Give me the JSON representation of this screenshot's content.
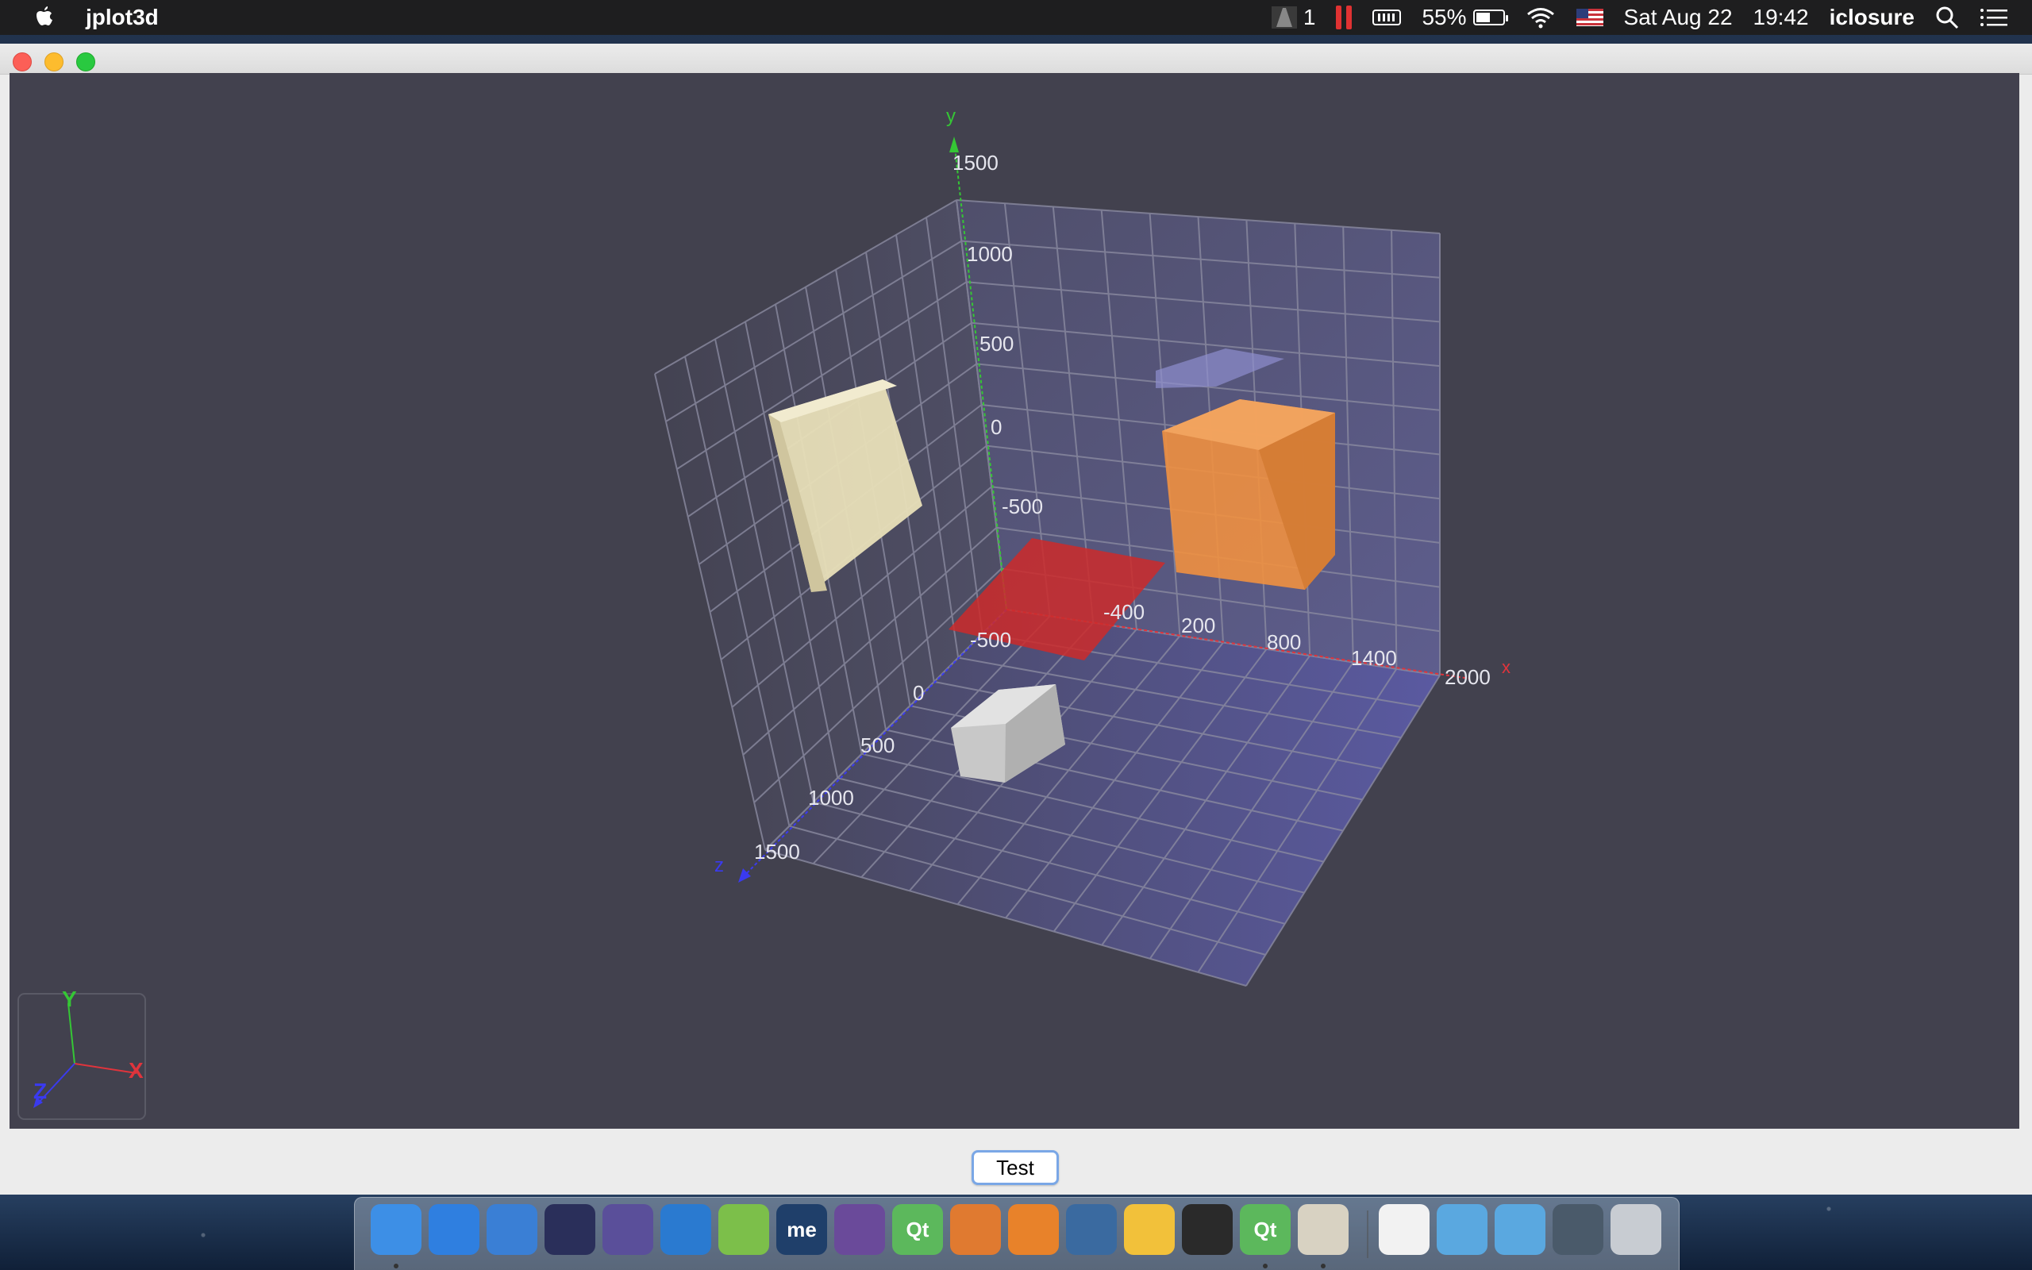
{
  "menubar": {
    "app_name": "jplot3d",
    "adobe_count": "1",
    "battery_percent": "55%",
    "battery_level": 0.55,
    "date": "Sat Aug 22",
    "time": "19:42",
    "user": "iclosure",
    "icons": [
      "apple-icon",
      "adobe-icon",
      "pause-icon",
      "memory-icon",
      "battery-icon",
      "wifi-icon",
      "us-flag-icon",
      "search-icon",
      "list-icon"
    ]
  },
  "window": {
    "title": ""
  },
  "plot": {
    "y_axis_label": "y",
    "x_axis_label": "x",
    "z_axis_label": "z",
    "y_ticks": [
      "1500",
      "1000",
      "500",
      "0",
      "-500"
    ],
    "x_ticks": [
      "-400",
      "200",
      "800",
      "1400",
      "2000"
    ],
    "z_ticks": [
      "-500",
      "0",
      "500",
      "1000",
      "1500"
    ],
    "axis_colors": {
      "x": "#e0343c",
      "y": "#35c635",
      "z": "#3a3aef"
    },
    "shapes": [
      {
        "name": "beige-box",
        "color": "#e8dfb8"
      },
      {
        "name": "lavender-plane",
        "color": "#8f8fcf"
      },
      {
        "name": "orange-box",
        "color": "#f09040"
      },
      {
        "name": "red-plane",
        "color": "#cc2a2a"
      },
      {
        "name": "gray-box",
        "color": "#d0d0d0"
      }
    ],
    "gizmo": {
      "x": "X",
      "y": "Y",
      "z": "Z"
    }
  },
  "button": {
    "test_label": "Test"
  },
  "dock": {
    "apps": [
      {
        "name": "finder",
        "label": ""
      },
      {
        "name": "safari",
        "label": ""
      },
      {
        "name": "xcode",
        "label": ""
      },
      {
        "name": "eclipse",
        "label": ""
      },
      {
        "name": "eclipse-alt",
        "label": ""
      },
      {
        "name": "vscode",
        "label": ""
      },
      {
        "name": "android-studio",
        "label": ""
      },
      {
        "name": "mindmanager",
        "label": "me"
      },
      {
        "name": "github",
        "label": ""
      },
      {
        "name": "qt-creator",
        "label": "Qt"
      },
      {
        "name": "matlab",
        "label": ""
      },
      {
        "name": "blender",
        "label": ""
      },
      {
        "name": "screen-sharing",
        "label": ""
      },
      {
        "name": "music-app",
        "label": ""
      },
      {
        "name": "terminal",
        "label": ""
      },
      {
        "name": "qt-designer",
        "label": "Qt"
      },
      {
        "name": "script-editor",
        "label": ""
      },
      {
        "name": "document",
        "label": ""
      },
      {
        "name": "folder-apps",
        "label": ""
      },
      {
        "name": "folder-windows",
        "label": ""
      },
      {
        "name": "screenshot-stack",
        "label": ""
      },
      {
        "name": "trash",
        "label": ""
      }
    ]
  }
}
